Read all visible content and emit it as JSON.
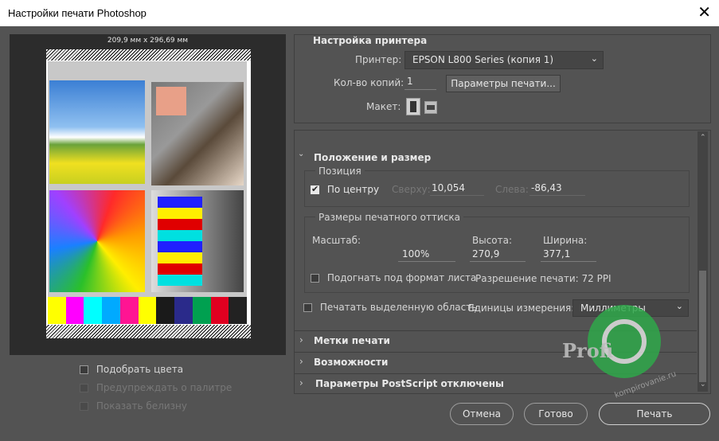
{
  "window": {
    "title": "Настройки печати Photoshop",
    "close_glyph": "✕"
  },
  "preview": {
    "dimensions": "209,9 мм x 296,69 мм",
    "bar_colors": [
      "#ffff00",
      "#ff00ff",
      "#00ffff",
      "#00aaff",
      "#ff1493",
      "#ffff00",
      "#1a1a1a",
      "#2a2a8a",
      "#00a050",
      "#e00020",
      "#222"
    ]
  },
  "left_options": {
    "match_colors": "Подобрать цвета",
    "gamut_warning": "Предупреждать о палитре",
    "show_paper_white": "Показать белизну"
  },
  "printer_setup": {
    "header": "Настройка принтера",
    "printer_label": "Принтер:",
    "printer_value": "EPSON L800 Series (копия 1)",
    "copies_label": "Кол-во копий:",
    "copies_value": "1",
    "print_settings_button": "Параметры печати...",
    "layout_label": "Макет:"
  },
  "position_size": {
    "header": "Положение и размер",
    "position_group": "Позиция",
    "center_label": "По центру",
    "top_label": "Сверху:",
    "top_value": "10,054",
    "left_label": "Слева:",
    "left_value": "-86,43",
    "scaled_group": "Размеры печатного оттиска",
    "scale_label": "Масштаб:",
    "scale_value": "100%",
    "height_label": "Высота:",
    "height_value": "270,9",
    "width_label": "Ширина:",
    "width_value": "377,1",
    "fit_label": "Подогнать под формат листа",
    "resolution": "Разрешение печати: 72 PPI",
    "print_selected": "Печатать выделенную область",
    "units_label": "Единицы измерения:",
    "units_value": "Миллиметры"
  },
  "collapsed_sections": [
    "Метки печати",
    "Возможности",
    "Параметры PostScript отключены"
  ],
  "watermark": {
    "text": "Profi",
    "site": "kompirovanie.ru"
  },
  "buttons": {
    "cancel": "Отмена",
    "done": "Готово",
    "print": "Печать"
  }
}
